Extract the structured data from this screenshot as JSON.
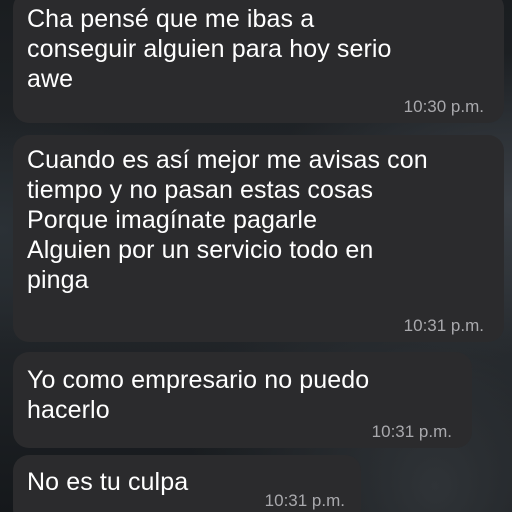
{
  "messages": [
    {
      "text": "Cha pensé que me ibas a\nconseguir alguien para hoy serio\nawe",
      "time": "10:30 p.m."
    },
    {
      "text": "Cuando es así mejor me avisas con\ntiempo y no pasan estas cosas\nPorque imagínate pagarle\nAlguien por un servicio todo en\npinga",
      "time": "10:31 p.m."
    },
    {
      "text": "Yo como empresario no puedo\nhacerlo",
      "time": "10:31 p.m."
    },
    {
      "text": "No es tu culpa",
      "time": "10:31 p.m."
    }
  ],
  "colors": {
    "bubble_background": "#2b2b2d",
    "text": "#ffffff",
    "timestamp": "#a9a9ad"
  }
}
